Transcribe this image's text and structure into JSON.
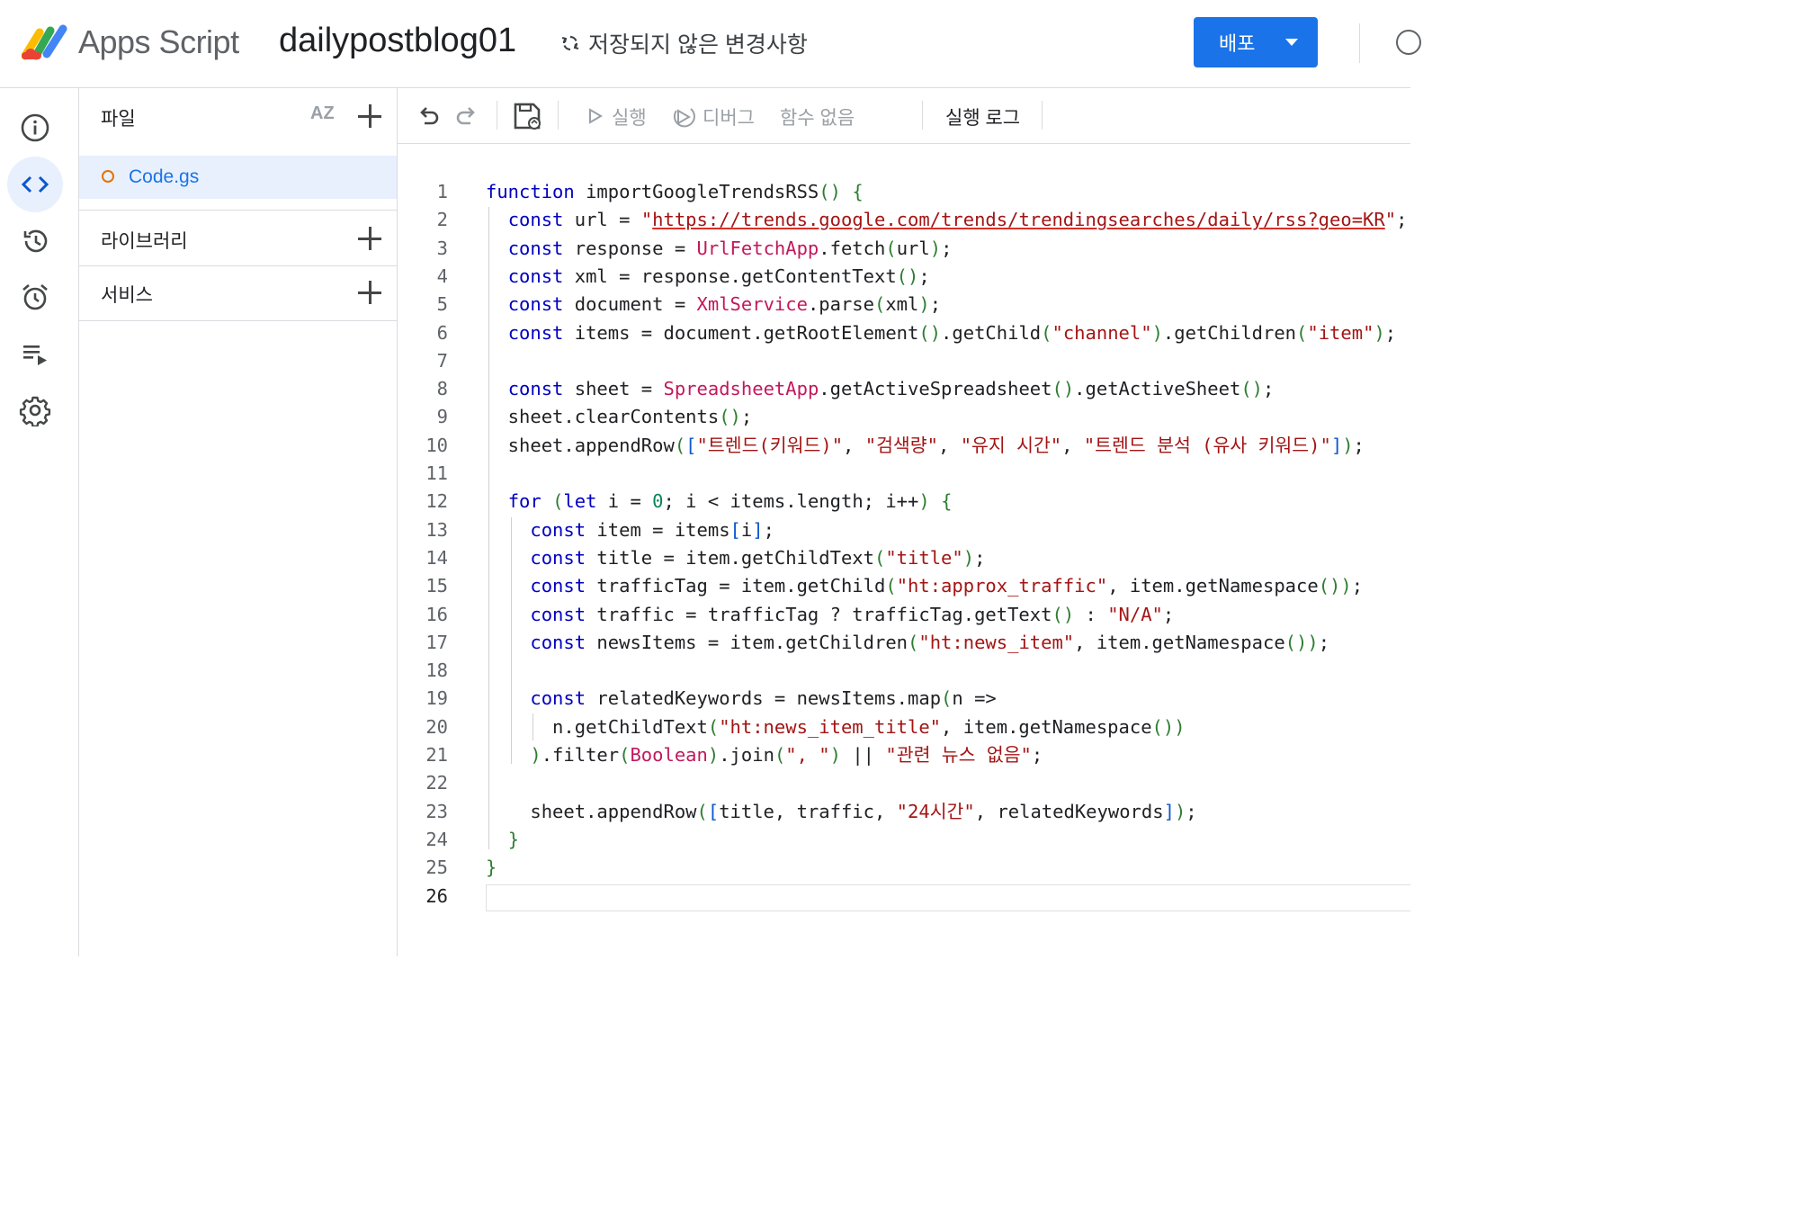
{
  "header": {
    "app_name": "Apps Script",
    "project_name": "dailypostblog01",
    "unsaved_status": "저장되지 않은 변경사항",
    "deploy_label": "배포",
    "accent_color": "#1a73e8"
  },
  "rail": {
    "items": [
      {
        "name": "overview",
        "icon": "info-icon"
      },
      {
        "name": "editor",
        "icon": "code-icon",
        "active": true
      },
      {
        "name": "project-history",
        "icon": "history-icon"
      },
      {
        "name": "triggers",
        "icon": "alarm-icon"
      },
      {
        "name": "executions",
        "icon": "executions-icon"
      },
      {
        "name": "settings",
        "icon": "gear-icon"
      }
    ]
  },
  "files_panel": {
    "files_label": "파일",
    "sort_label": "AZ",
    "files": [
      {
        "name": "Code.gs"
      }
    ],
    "libraries_label": "라이브러리",
    "services_label": "서비스"
  },
  "toolbar": {
    "run_label": "실행",
    "debug_label": "디버그",
    "function_label": "함수 없음",
    "log_label": "실행 로그"
  },
  "editor": {
    "line_count": 26,
    "lines": [
      "function importGoogleTrendsRSS() {",
      "  const url = \"https://trends.google.com/trends/trendingsearches/daily/rss?geo=KR\";",
      "  const response = UrlFetchApp.fetch(url);",
      "  const xml = response.getContentText();",
      "  const document = XmlService.parse(xml);",
      "  const items = document.getRootElement().getChild(\"channel\").getChildren(\"item\");",
      "",
      "  const sheet = SpreadsheetApp.getActiveSpreadsheet().getActiveSheet();",
      "  sheet.clearContents();",
      "  sheet.appendRow([\"트렌드(키워드)\", \"검색량\", \"유지 시간\", \"트렌드 분석 (유사 키워드)\"]);",
      "",
      "  for (let i = 0; i < items.length; i++) {",
      "    const item = items[i];",
      "    const title = item.getChildText(\"title\");",
      "    const trafficTag = item.getChild(\"ht:approx_traffic\", item.getNamespace());",
      "    const traffic = trafficTag ? trafficTag.getText() : \"N/A\";",
      "    const newsItems = item.getChildren(\"ht:news_item\", item.getNamespace());",
      "",
      "    const relatedKeywords = newsItems.map(n =>",
      "      n.getChildText(\"ht:news_item_title\", item.getNamespace())",
      "    ).filter(Boolean).join(\", \") || \"관련 뉴스 없음\";",
      "",
      "    sheet.appendRow([title, traffic, \"24시간\", relatedKeywords]);",
      "  }",
      "}",
      ""
    ]
  }
}
